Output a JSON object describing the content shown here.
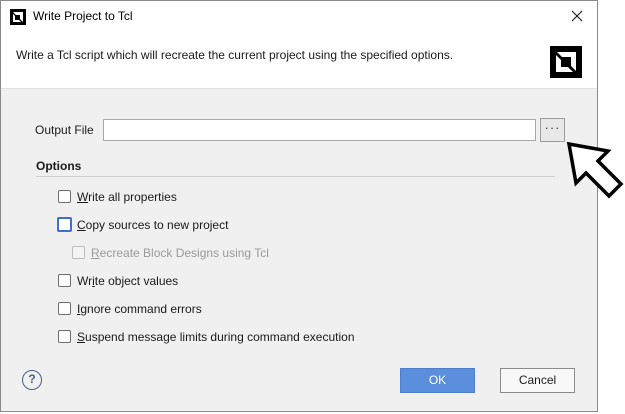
{
  "window": {
    "title": "Write Project to Tcl"
  },
  "banner": {
    "text": "Write a Tcl script which will recreate the current project using the specified options."
  },
  "output_file": {
    "label": "Output File",
    "value": "",
    "browse_label": "···"
  },
  "options": {
    "heading": "Options",
    "items": [
      {
        "mnemonic": "W",
        "rest": "rite all properties",
        "checked": false,
        "enabled": true
      },
      {
        "mnemonic": "C",
        "rest": "opy sources to new project",
        "checked": false,
        "enabled": true,
        "focused": true
      },
      {
        "mnemonic": "R",
        "rest": "ecreate Block Designs using Tcl",
        "checked": false,
        "enabled": false
      },
      {
        "pre": "Wr",
        "mnemonic": "i",
        "rest": "te object values",
        "checked": false,
        "enabled": true
      },
      {
        "mnemonic": "I",
        "rest": "gnore command errors",
        "checked": false,
        "enabled": true
      },
      {
        "mnemonic": "S",
        "rest": "uspend message limits during command execution",
        "checked": false,
        "enabled": true
      }
    ]
  },
  "footer": {
    "help_label": "?",
    "ok_label": "OK",
    "cancel_label": "Cancel"
  },
  "colors": {
    "primary": "#5b8edc",
    "focus": "#3a6fcc",
    "dialog_bg": "#f0f0f0"
  },
  "icons": {
    "app": "amd-logo-icon",
    "close": "close-icon",
    "help": "help-icon",
    "cursor": "mouse-pointer-icon"
  }
}
